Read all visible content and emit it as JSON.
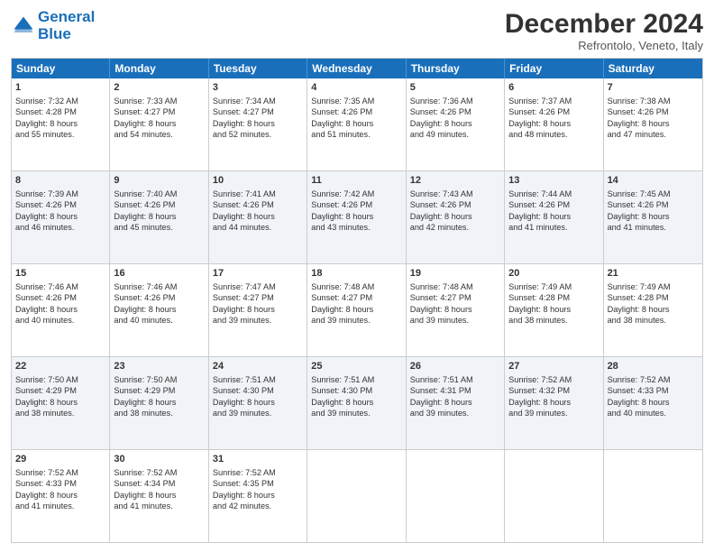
{
  "header": {
    "logo_line1": "General",
    "logo_line2": "Blue",
    "month": "December 2024",
    "location": "Refrontolo, Veneto, Italy"
  },
  "weekdays": [
    "Sunday",
    "Monday",
    "Tuesday",
    "Wednesday",
    "Thursday",
    "Friday",
    "Saturday"
  ],
  "rows": [
    {
      "alt": false,
      "cells": [
        {
          "day": "1",
          "lines": [
            "Sunrise: 7:32 AM",
            "Sunset: 4:28 PM",
            "Daylight: 8 hours",
            "and 55 minutes."
          ]
        },
        {
          "day": "2",
          "lines": [
            "Sunrise: 7:33 AM",
            "Sunset: 4:27 PM",
            "Daylight: 8 hours",
            "and 54 minutes."
          ]
        },
        {
          "day": "3",
          "lines": [
            "Sunrise: 7:34 AM",
            "Sunset: 4:27 PM",
            "Daylight: 8 hours",
            "and 52 minutes."
          ]
        },
        {
          "day": "4",
          "lines": [
            "Sunrise: 7:35 AM",
            "Sunset: 4:26 PM",
            "Daylight: 8 hours",
            "and 51 minutes."
          ]
        },
        {
          "day": "5",
          "lines": [
            "Sunrise: 7:36 AM",
            "Sunset: 4:26 PM",
            "Daylight: 8 hours",
            "and 49 minutes."
          ]
        },
        {
          "day": "6",
          "lines": [
            "Sunrise: 7:37 AM",
            "Sunset: 4:26 PM",
            "Daylight: 8 hours",
            "and 48 minutes."
          ]
        },
        {
          "day": "7",
          "lines": [
            "Sunrise: 7:38 AM",
            "Sunset: 4:26 PM",
            "Daylight: 8 hours",
            "and 47 minutes."
          ]
        }
      ]
    },
    {
      "alt": true,
      "cells": [
        {
          "day": "8",
          "lines": [
            "Sunrise: 7:39 AM",
            "Sunset: 4:26 PM",
            "Daylight: 8 hours",
            "and 46 minutes."
          ]
        },
        {
          "day": "9",
          "lines": [
            "Sunrise: 7:40 AM",
            "Sunset: 4:26 PM",
            "Daylight: 8 hours",
            "and 45 minutes."
          ]
        },
        {
          "day": "10",
          "lines": [
            "Sunrise: 7:41 AM",
            "Sunset: 4:26 PM",
            "Daylight: 8 hours",
            "and 44 minutes."
          ]
        },
        {
          "day": "11",
          "lines": [
            "Sunrise: 7:42 AM",
            "Sunset: 4:26 PM",
            "Daylight: 8 hours",
            "and 43 minutes."
          ]
        },
        {
          "day": "12",
          "lines": [
            "Sunrise: 7:43 AM",
            "Sunset: 4:26 PM",
            "Daylight: 8 hours",
            "and 42 minutes."
          ]
        },
        {
          "day": "13",
          "lines": [
            "Sunrise: 7:44 AM",
            "Sunset: 4:26 PM",
            "Daylight: 8 hours",
            "and 41 minutes."
          ]
        },
        {
          "day": "14",
          "lines": [
            "Sunrise: 7:45 AM",
            "Sunset: 4:26 PM",
            "Daylight: 8 hours",
            "and 41 minutes."
          ]
        }
      ]
    },
    {
      "alt": false,
      "cells": [
        {
          "day": "15",
          "lines": [
            "Sunrise: 7:46 AM",
            "Sunset: 4:26 PM",
            "Daylight: 8 hours",
            "and 40 minutes."
          ]
        },
        {
          "day": "16",
          "lines": [
            "Sunrise: 7:46 AM",
            "Sunset: 4:26 PM",
            "Daylight: 8 hours",
            "and 40 minutes."
          ]
        },
        {
          "day": "17",
          "lines": [
            "Sunrise: 7:47 AM",
            "Sunset: 4:27 PM",
            "Daylight: 8 hours",
            "and 39 minutes."
          ]
        },
        {
          "day": "18",
          "lines": [
            "Sunrise: 7:48 AM",
            "Sunset: 4:27 PM",
            "Daylight: 8 hours",
            "and 39 minutes."
          ]
        },
        {
          "day": "19",
          "lines": [
            "Sunrise: 7:48 AM",
            "Sunset: 4:27 PM",
            "Daylight: 8 hours",
            "and 39 minutes."
          ]
        },
        {
          "day": "20",
          "lines": [
            "Sunrise: 7:49 AM",
            "Sunset: 4:28 PM",
            "Daylight: 8 hours",
            "and 38 minutes."
          ]
        },
        {
          "day": "21",
          "lines": [
            "Sunrise: 7:49 AM",
            "Sunset: 4:28 PM",
            "Daylight: 8 hours",
            "and 38 minutes."
          ]
        }
      ]
    },
    {
      "alt": true,
      "cells": [
        {
          "day": "22",
          "lines": [
            "Sunrise: 7:50 AM",
            "Sunset: 4:29 PM",
            "Daylight: 8 hours",
            "and 38 minutes."
          ]
        },
        {
          "day": "23",
          "lines": [
            "Sunrise: 7:50 AM",
            "Sunset: 4:29 PM",
            "Daylight: 8 hours",
            "and 38 minutes."
          ]
        },
        {
          "day": "24",
          "lines": [
            "Sunrise: 7:51 AM",
            "Sunset: 4:30 PM",
            "Daylight: 8 hours",
            "and 39 minutes."
          ]
        },
        {
          "day": "25",
          "lines": [
            "Sunrise: 7:51 AM",
            "Sunset: 4:30 PM",
            "Daylight: 8 hours",
            "and 39 minutes."
          ]
        },
        {
          "day": "26",
          "lines": [
            "Sunrise: 7:51 AM",
            "Sunset: 4:31 PM",
            "Daylight: 8 hours",
            "and 39 minutes."
          ]
        },
        {
          "day": "27",
          "lines": [
            "Sunrise: 7:52 AM",
            "Sunset: 4:32 PM",
            "Daylight: 8 hours",
            "and 39 minutes."
          ]
        },
        {
          "day": "28",
          "lines": [
            "Sunrise: 7:52 AM",
            "Sunset: 4:33 PM",
            "Daylight: 8 hours",
            "and 40 minutes."
          ]
        }
      ]
    },
    {
      "alt": false,
      "cells": [
        {
          "day": "29",
          "lines": [
            "Sunrise: 7:52 AM",
            "Sunset: 4:33 PM",
            "Daylight: 8 hours",
            "and 41 minutes."
          ]
        },
        {
          "day": "30",
          "lines": [
            "Sunrise: 7:52 AM",
            "Sunset: 4:34 PM",
            "Daylight: 8 hours",
            "and 41 minutes."
          ]
        },
        {
          "day": "31",
          "lines": [
            "Sunrise: 7:52 AM",
            "Sunset: 4:35 PM",
            "Daylight: 8 hours",
            "and 42 minutes."
          ]
        },
        {
          "day": "",
          "lines": []
        },
        {
          "day": "",
          "lines": []
        },
        {
          "day": "",
          "lines": []
        },
        {
          "day": "",
          "lines": []
        }
      ]
    }
  ]
}
